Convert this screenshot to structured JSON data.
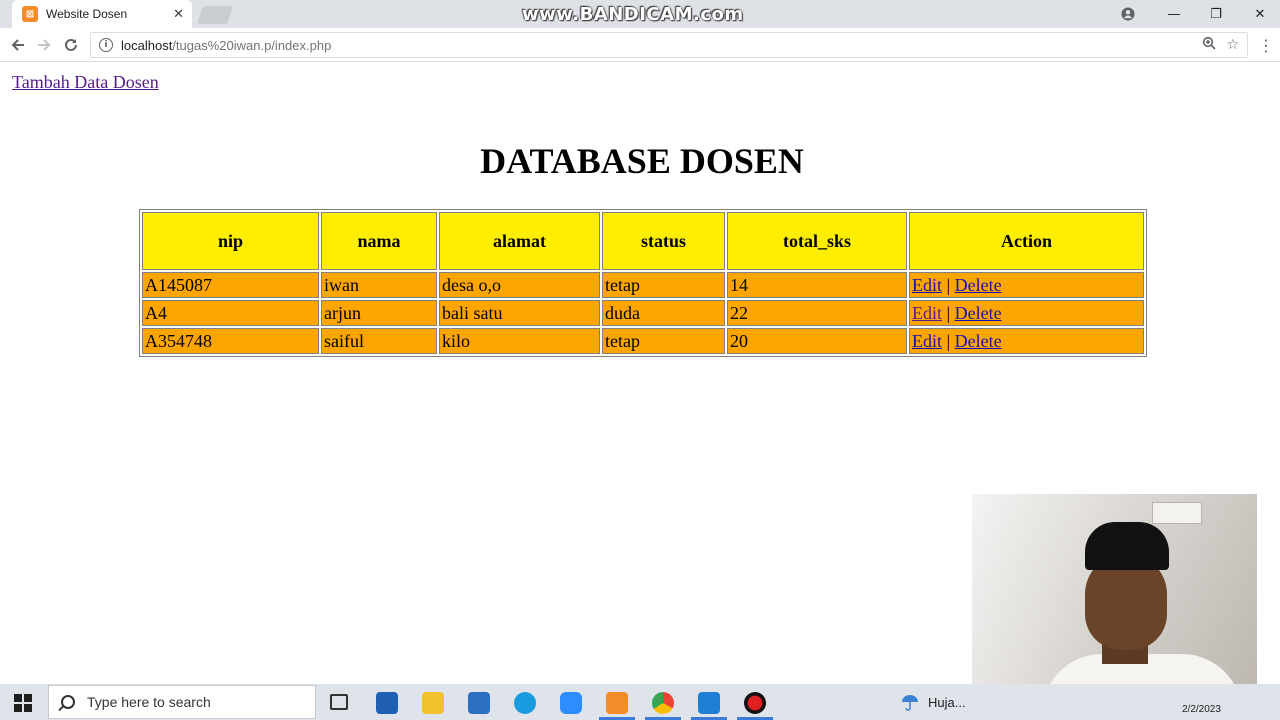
{
  "browser": {
    "tab_title": "Website Dosen",
    "tab_close": "✕",
    "watermark": "www.BANDICAM.com",
    "url_host": "localhost",
    "url_path": "/tugas%20iwan.p/index.php",
    "window_controls": {
      "minimize": "—",
      "maximize": "❐",
      "close": "✕"
    }
  },
  "page": {
    "add_link": "Tambah Data Dosen",
    "heading": "DATABASE DOSEN",
    "table": {
      "headers": [
        "nip",
        "nama",
        "alamat",
        "status",
        "total_sks",
        "Action"
      ],
      "rows": [
        {
          "nip": "A145087",
          "nama": "iwan",
          "alamat": "desa o,o",
          "status": "tetap",
          "total_sks": "14",
          "edit": "Edit",
          "sep": "|",
          "delete": "Delete"
        },
        {
          "nip": "A4",
          "nama": "arjun",
          "alamat": "bali satu",
          "status": "duda",
          "total_sks": "22",
          "edit": "Edit",
          "sep": "|",
          "delete": "Delete"
        },
        {
          "nip": "A354748",
          "nama": "saiful",
          "alamat": "kilo",
          "status": "tetap",
          "total_sks": "20",
          "edit": "Edit",
          "sep": "|",
          "delete": "Delete"
        }
      ]
    }
  },
  "taskbar": {
    "search_placeholder": "Type here to search",
    "weather_text": "Huja...",
    "date": "2/2/2023"
  },
  "colors": {
    "header_bg": "#ffee00",
    "row_bg": "#ffa500",
    "link": "#1a0dab",
    "visited_link": "#551a8b"
  }
}
